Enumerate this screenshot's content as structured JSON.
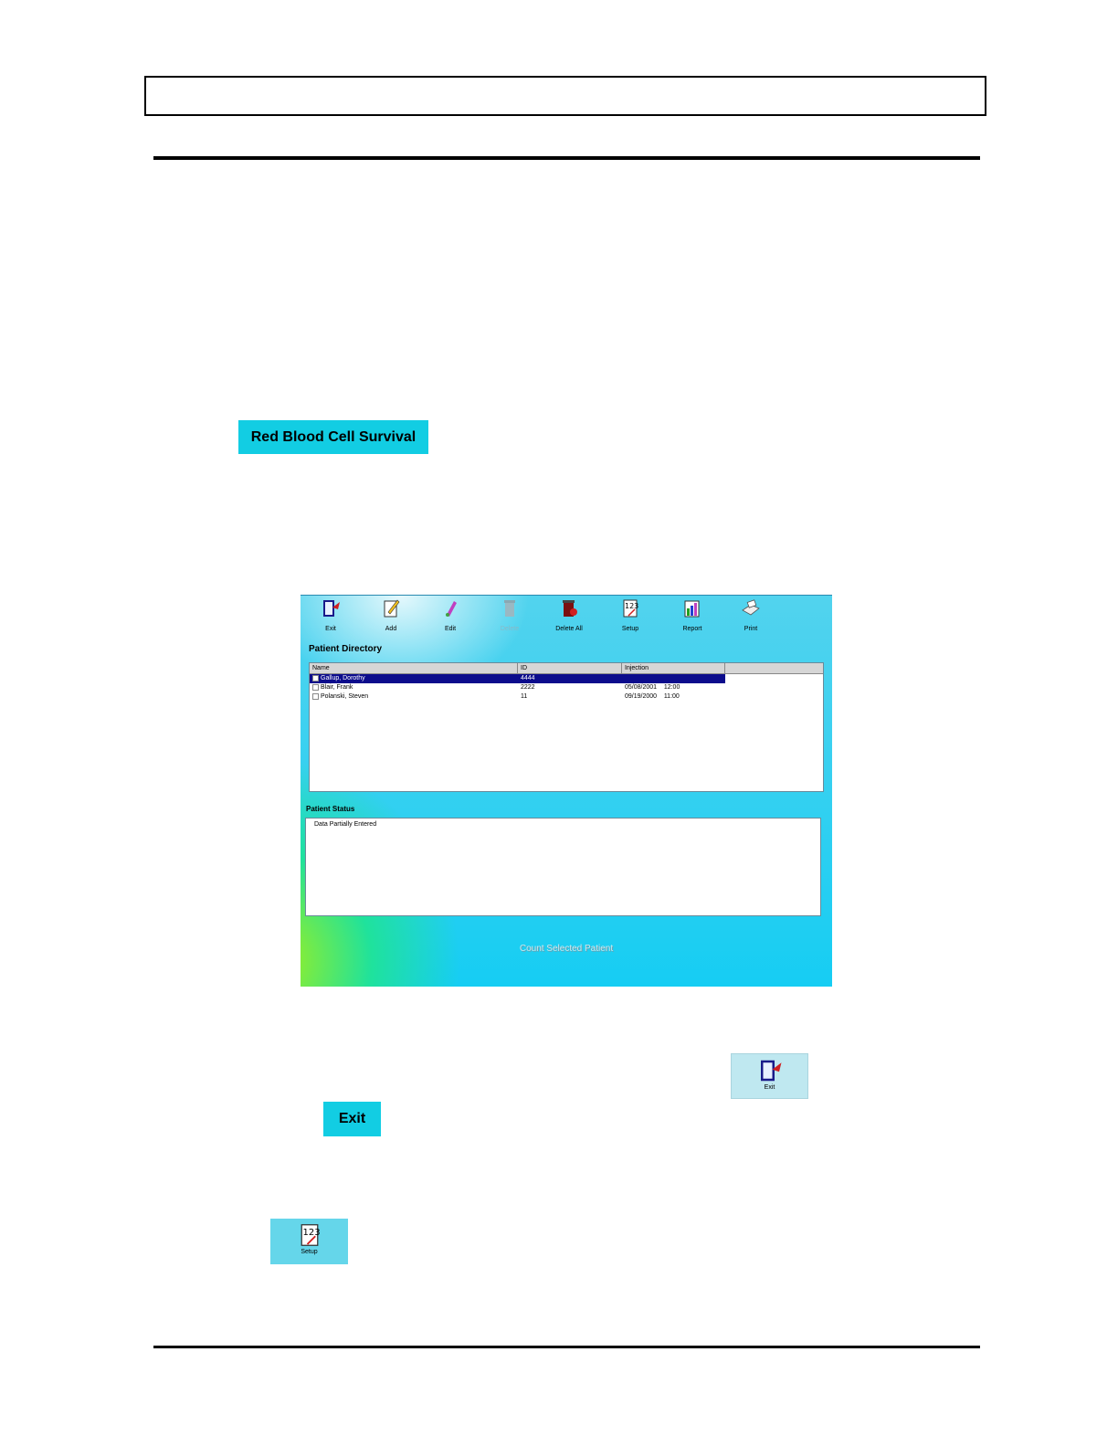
{
  "rbc_button": {
    "label": "Red Blood Cell Survival"
  },
  "app": {
    "toolbar": [
      {
        "label": "Exit",
        "icon": "exit-door-icon"
      },
      {
        "label": "Add",
        "icon": "add-pencil-icon"
      },
      {
        "label": "Edit",
        "icon": "edit-pen-icon"
      },
      {
        "label": "Delete",
        "icon": "delete-trash-icon",
        "disabled": true
      },
      {
        "label": "Delete All",
        "icon": "delete-all-icon"
      },
      {
        "label": "Setup",
        "icon": "setup-calendar-icon"
      },
      {
        "label": "Report",
        "icon": "report-chart-icon"
      },
      {
        "label": "Print",
        "icon": "print-printer-icon"
      }
    ],
    "directory_title": "Patient Directory",
    "columns": [
      "Name",
      "ID",
      "Injection"
    ],
    "patients": [
      {
        "name": "Gallup, Dorothy",
        "id": "4444",
        "injection": "",
        "selected": true
      },
      {
        "name": "Blair, Frank",
        "id": "2222",
        "injection": "05/08/2001    12:00",
        "selected": false
      },
      {
        "name": "Polanski, Steven",
        "id": "11",
        "injection": "09/19/2000    11:00",
        "selected": false
      }
    ],
    "status_title": "Patient Status",
    "status_text": "Data Partially Entered",
    "count_button": "Count Selected Patient"
  },
  "exit_icon_button": {
    "label": "Exit"
  },
  "exit_text_button": {
    "label": "Exit"
  },
  "setup_icon_button": {
    "label": "Setup"
  }
}
